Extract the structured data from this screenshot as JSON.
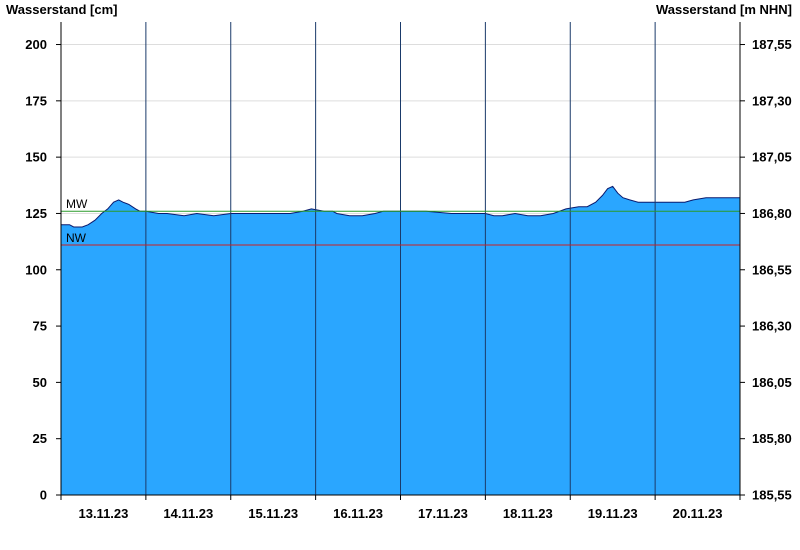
{
  "chart_data": {
    "type": "area",
    "title": "",
    "ylabel": "Wasserstand [cm]",
    "ylabel_right": "Wasserstand [m NHN]",
    "ylim": [
      0,
      210
    ],
    "yticks": [
      0,
      25,
      50,
      75,
      100,
      125,
      150,
      175,
      200
    ],
    "yticks_right": [
      "185,55",
      "185,80",
      "186,05",
      "186,30",
      "186,55",
      "186,80",
      "187,05",
      "187,30",
      "187,55"
    ],
    "xlim": [
      0,
      8
    ],
    "xtick_labels": [
      "13.11.23",
      "14.11.23",
      "15.11.23",
      "16.11.23",
      "17.11.23",
      "18.11.23",
      "19.11.23",
      "20.11.23"
    ],
    "grid": true,
    "colors": {
      "fill": "#2aa6ff",
      "outline": "#0a1a6e",
      "mw": "#2a9a2a",
      "nw": "#cc2020",
      "grid": "#dddddd",
      "daygrid": "#1a3a6a"
    },
    "reference_lines": [
      {
        "label": "MW",
        "value": 126,
        "color": "#2a9a2a"
      },
      {
        "label": "NW",
        "value": 111,
        "color": "#cc2020"
      }
    ],
    "series": [
      {
        "x": [
          0.0,
          0.1,
          0.15,
          0.25,
          0.32,
          0.4,
          0.48,
          0.55,
          0.62,
          0.68,
          0.73,
          0.8,
          0.88,
          0.93,
          1.0,
          1.15,
          1.25,
          1.45,
          1.6,
          1.8,
          2.0,
          2.2,
          2.45,
          2.7,
          2.85,
          2.95,
          3.1,
          3.2,
          3.25,
          3.4,
          3.55,
          3.7,
          3.8,
          4.0,
          4.3,
          4.6,
          4.8,
          5.0,
          5.1,
          5.2,
          5.35,
          5.5,
          5.65,
          5.8,
          5.95,
          6.1,
          6.2,
          6.3,
          6.38,
          6.44,
          6.5,
          6.56,
          6.62,
          6.7,
          6.8,
          6.9,
          7.1,
          7.35,
          7.45,
          7.6,
          8.0
        ],
        "y": [
          120,
          120,
          119,
          119,
          120,
          122,
          125,
          127,
          130,
          131,
          130,
          129,
          127,
          126,
          126,
          125,
          125,
          124,
          125,
          124,
          125,
          125,
          125,
          125,
          126,
          127,
          126,
          126,
          125,
          124,
          124,
          125,
          126,
          126,
          126,
          125,
          125,
          125,
          124,
          124,
          125,
          124,
          124,
          125,
          127,
          128,
          128,
          130,
          133,
          136,
          137,
          134,
          132,
          131,
          130,
          130,
          130,
          130,
          131,
          132,
          132
        ]
      }
    ]
  }
}
